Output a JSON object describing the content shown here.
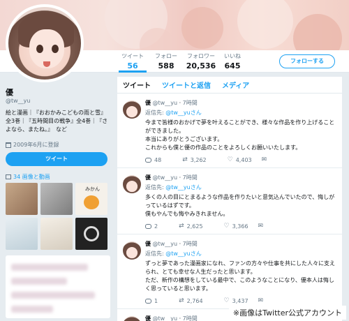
{
  "nav": {
    "stats": [
      {
        "label": "ツイート",
        "value": "56"
      },
      {
        "label": "フォロー",
        "value": "588"
      },
      {
        "label": "フォロワー",
        "value": "20,536"
      },
      {
        "label": "いいね",
        "value": "645"
      }
    ],
    "follow_label": "フォローする"
  },
  "profile": {
    "name": "優",
    "handle": "@tw__yu",
    "bio": "絵と漫画｜『おおかみこどもの雨と雪』全3巻｜『五時間目の戦争』全4巻｜『さよなら、またね。』　など",
    "joined": "2009年6月に登録",
    "tweet_button": "ツイート",
    "media_link": "34 画像と動画",
    "thumb_text": "みかん"
  },
  "timeline": {
    "tabs": [
      "ツイート",
      "ツイートと返信",
      "メディア"
    ],
    "tweets": [
      {
        "name": "優",
        "handle": "@tw__yu",
        "time": "7時間",
        "reply_prefix": "返信先:",
        "reply_to": "@tw__yuさん",
        "body": "今まで皆様のおかげで夢を叶えることができ、様々な作品を作り上げることができました。\n本当にありがとうございます。\nこれからも僕と優の作品のことをよろしくお願いいたします。",
        "replies": "48",
        "retweets": "3,262",
        "likes": "4,403"
      },
      {
        "name": "優",
        "handle": "@tw__yu",
        "time": "7時間",
        "reply_prefix": "返信先:",
        "reply_to": "@tw__yuさん",
        "body": "多くの人の目にとまるような作品を作りたいと意気込んでいたので、悔しがっているはずです。\n僕もやんでも悔やみきれません。",
        "replies": "2",
        "retweets": "2,625",
        "likes": "3,366"
      },
      {
        "name": "優",
        "handle": "@tw__yu",
        "time": "7時間",
        "reply_prefix": "返信先:",
        "reply_to": "@tw__yuさん",
        "body": "ずっと夢であった漫画家になれ、ファンの方々や仕事を共にした人々に支えられ、とても幸せな人生だったと思います。\nただ、新作の構想をしている最中で、このようなことになり、優本人は悔しく思っていると思います。",
        "replies": "1",
        "retweets": "2,764",
        "likes": "3,437"
      },
      {
        "name": "優",
        "handle": "@tw__yu",
        "time": "7時間",
        "reply_prefix": "",
        "reply_to": "",
        "body": "",
        "replies": "",
        "retweets": "",
        "likes": ""
      }
    ]
  },
  "caption": "※画像はTwitter公式アカウント",
  "colors": {
    "accent": "#1da1f2",
    "background": "#e6ecf0"
  }
}
